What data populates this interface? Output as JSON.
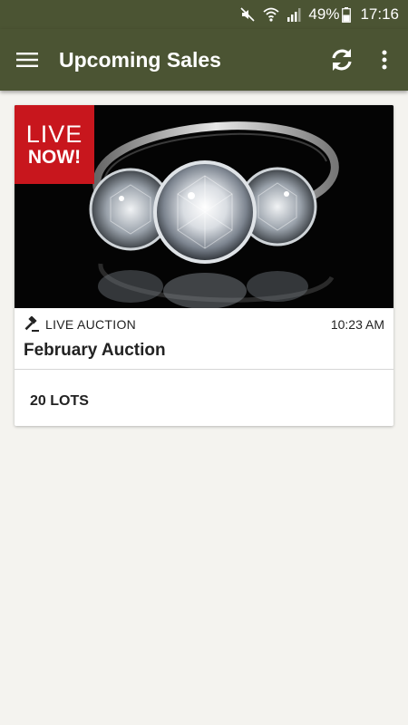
{
  "status_bar": {
    "battery": "49%",
    "time": "17:16",
    "icons": [
      "mute-icon",
      "wifi-icon",
      "signal-icon",
      "battery-icon"
    ]
  },
  "app_bar": {
    "title": "Upcoming Sales",
    "icons": [
      "menu-icon",
      "refresh-icon",
      "overflow-icon"
    ]
  },
  "sales": [
    {
      "badge_line1": "LIVE",
      "badge_line2": "NOW!",
      "type": "LIVE AUCTION",
      "time": "10:23 AM",
      "title": "February Auction",
      "lots": "20 LOTS"
    }
  ],
  "colors": {
    "primary": "#4b5433",
    "badge": "#c8161d",
    "background": "#f4f3ef"
  }
}
